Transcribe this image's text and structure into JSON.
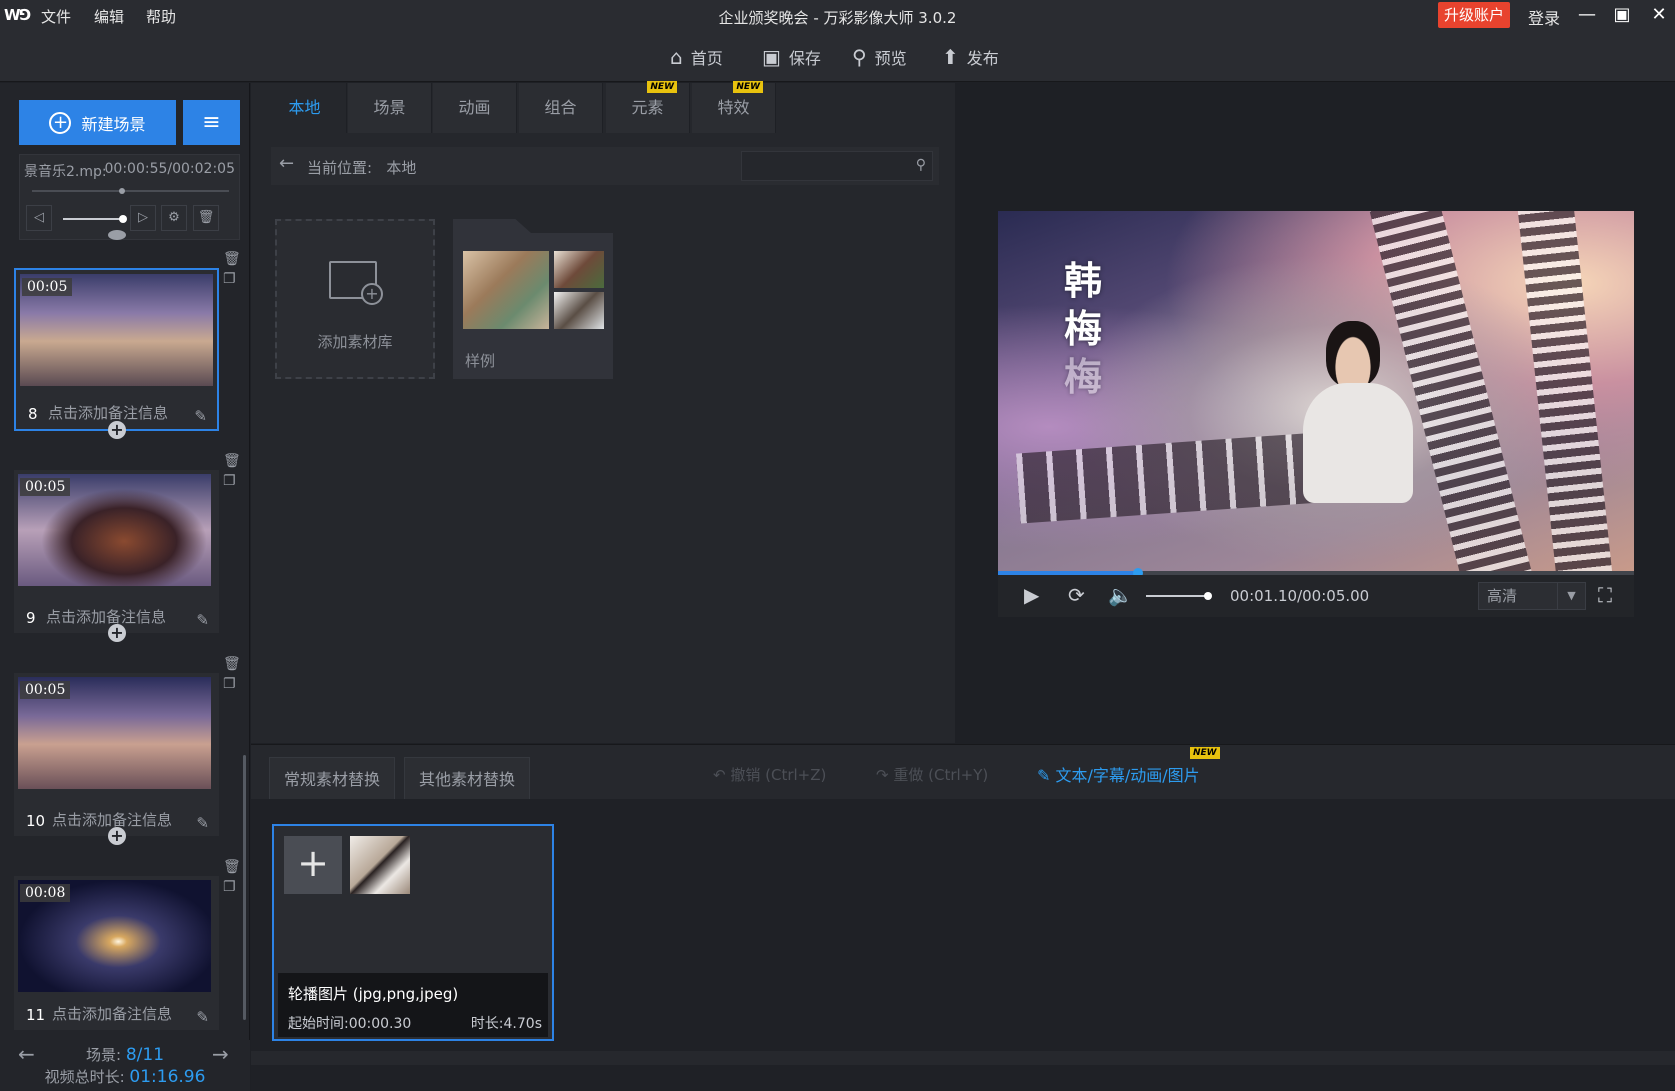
{
  "titlebar": {
    "logo": "W⅁",
    "menus": [
      "文件",
      "编辑",
      "帮助"
    ],
    "title": "企业颁奖晚会 - 万彩影像大师 3.0.2",
    "upgrade": "升级账户",
    "login": "登录",
    "min": "—",
    "max": "▣",
    "close": "✕"
  },
  "toolbar": {
    "home": "首页",
    "save": "保存",
    "preview": "预览",
    "publish": "发布"
  },
  "sidebar": {
    "new_scene": "新建场景",
    "music": {
      "name": "景音乐2.mp:",
      "time": "00:00:55/00:02:05"
    },
    "scenes": [
      {
        "duration": "00:05",
        "number": "8",
        "note": "点击添加备注信息"
      },
      {
        "duration": "00:05",
        "number": "9",
        "note": "点击添加备注信息"
      },
      {
        "duration": "00:05",
        "number": "10",
        "note": "点击添加备注信息"
      },
      {
        "duration": "00:08",
        "number": "11",
        "note": "点击添加备注信息"
      }
    ],
    "footer": {
      "scene_label": "场景:",
      "scene_value": "8/11",
      "total_label": "视频总时长:",
      "total_value": "01:16.96"
    }
  },
  "library": {
    "tabs": [
      "本地",
      "场景",
      "动画",
      "组合",
      "元素",
      "特效"
    ],
    "new_badge": "NEW",
    "path_label": "当前位置:",
    "path_value": "本地",
    "search_placeholder": "",
    "add_library": "添加素材库",
    "sample_folder": "样例"
  },
  "preview": {
    "video_text": [
      "韩",
      "梅",
      "梅"
    ],
    "time": "00:01.10/00:05.00",
    "quality": "高清",
    "progress": 0.22,
    "volume": 1.0
  },
  "bottom": {
    "tabs": [
      "常规素材替换",
      "其他素材替换"
    ],
    "undo": "撤销 (Ctrl+Z)",
    "redo": "重做 (Ctrl+Y)",
    "text_tool": "文本/字幕/动画/图片",
    "new_badge": "NEW",
    "card": {
      "title": "轮播图片 (jpg,png,jpeg)",
      "start": "起始时间:00:00.30",
      "duration": "时长:4.70s"
    }
  }
}
